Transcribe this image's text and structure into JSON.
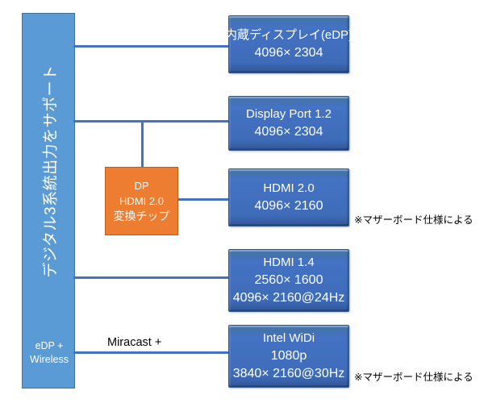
{
  "diagram": {
    "title": "Digital 3-output support diagram",
    "colors": {
      "source_bar": "#5B9BD5",
      "output_box": "#4472C4",
      "converter_chip": "#ED7D31",
      "connector_line": "#4472C4",
      "box_border": "#2F5597",
      "text_on_fill": "#FFFFFF",
      "note_text": "#000000",
      "background": "#FFFFFF"
    }
  },
  "source": {
    "vertical_label": "デジタル3系統出力をサポート",
    "bottom_label_line1": "eDP +",
    "bottom_label_line2": "Wireless"
  },
  "outputs": [
    {
      "id": "edp",
      "line1": "内蔵ディスプレイ(eDP)",
      "line2": "4096× 2304",
      "line3": ""
    },
    {
      "id": "displayport",
      "line1": "Display Port 1.2",
      "line2": "4096× 2304",
      "line3": ""
    },
    {
      "id": "hdmi20",
      "line1": "HDMI 2.0",
      "line2": "4096× 2160",
      "line3": ""
    },
    {
      "id": "hdmi14",
      "line1": "HDMI 1.4",
      "line2": "2560× 1600",
      "line3": "4096× 2160@24Hz"
    },
    {
      "id": "intel_widi",
      "line1": "Intel WiDi",
      "line2": "1080p",
      "line3": "3840× 2160@30Hz"
    }
  ],
  "converter_chip": {
    "line1": "DP",
    "line2": "HDMI 2.0",
    "line3": "変換チップ"
  },
  "connector_labels": {
    "miracast": "Miracast +"
  },
  "notes": {
    "hdmi20_note": "※マザーボード仕様による",
    "widi_note": "※マザーボード仕様による"
  }
}
